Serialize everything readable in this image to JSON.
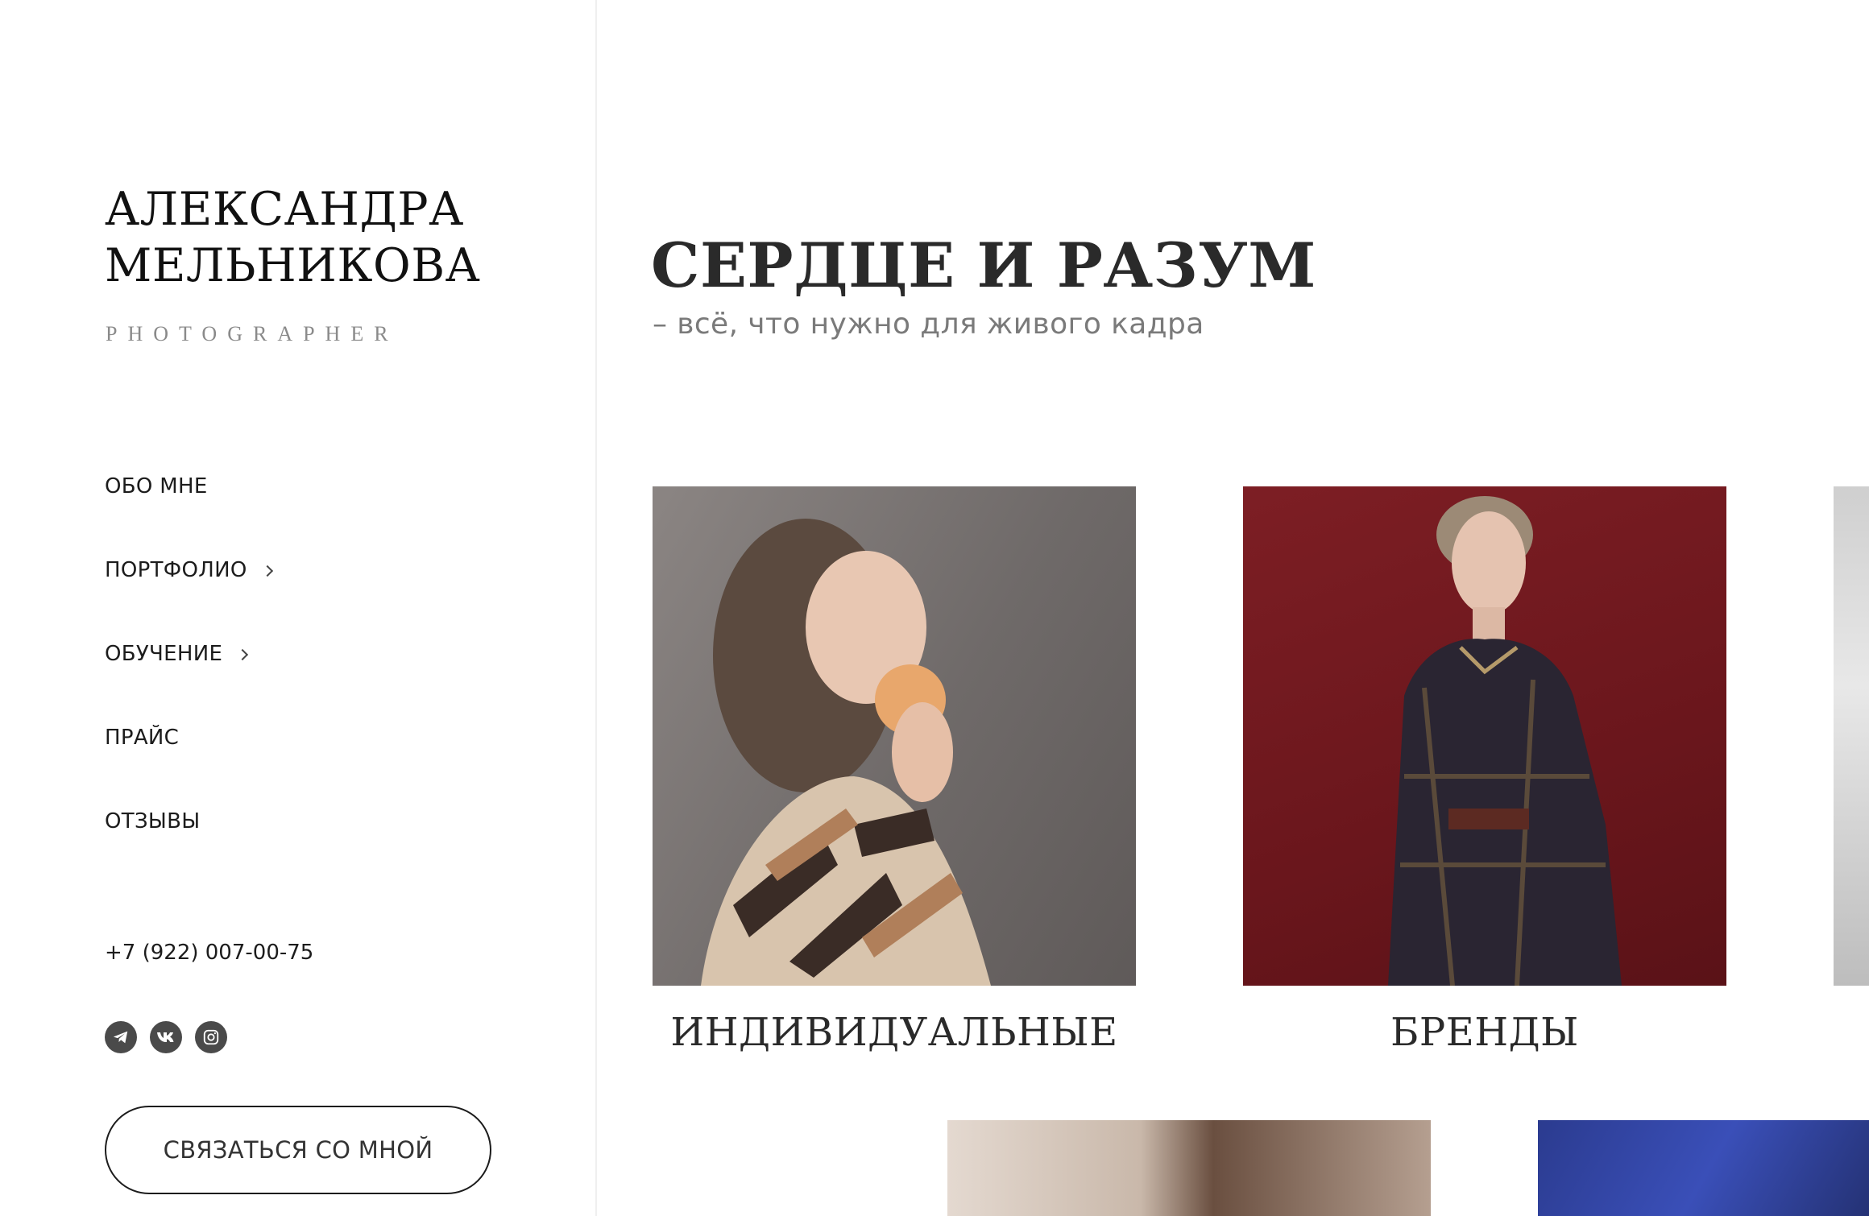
{
  "brand": {
    "name_line1": "АЛЕКСАНДРА",
    "name_line2": "МЕЛЬНИКОВА",
    "tagline": "PHOTOGRAPHER"
  },
  "nav": {
    "about": "ОБО МНЕ",
    "portfolio": "ПОРТФОЛИО",
    "training": "ОБУЧЕНИЕ",
    "price": "ПРАЙС",
    "reviews": "ОТЗЫВЫ"
  },
  "contact": {
    "phone": "+7 (922) 007-00-75",
    "cta_label": "СВЯЗАТЬСЯ СО МНОЙ",
    "socials": [
      "telegram-icon",
      "vk-icon",
      "instagram-icon"
    ]
  },
  "hero": {
    "title": "СЕРДЦЕ И РАЗУМ",
    "subtitle": "– всё, что нужно для живого кадра"
  },
  "cards": [
    {
      "label": "ИНДИВИДУАЛЬНЫЕ"
    },
    {
      "label": "БРЕНДЫ"
    }
  ],
  "colors": {
    "text": "#1c1c1c",
    "muted": "#7a7a7a",
    "brand_red": "#6a161c",
    "icon_bg": "#4a4a4a"
  }
}
